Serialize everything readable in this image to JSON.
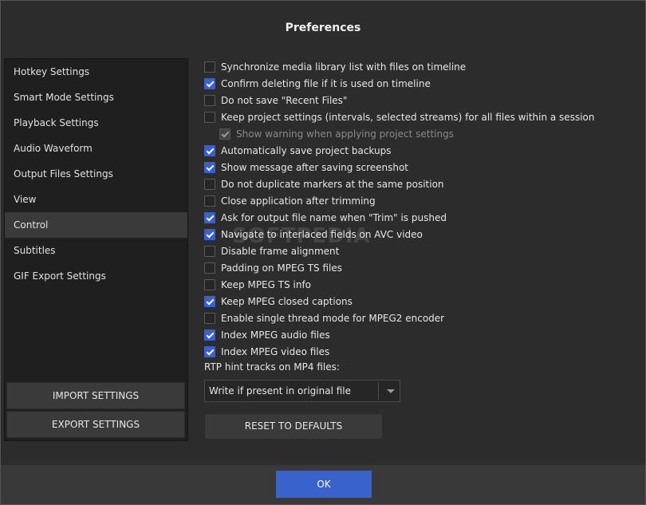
{
  "dialog": {
    "title": "Preferences"
  },
  "sidebar": {
    "items": [
      {
        "label": "Hotkey Settings"
      },
      {
        "label": "Smart Mode Settings"
      },
      {
        "label": "Playback Settings"
      },
      {
        "label": "Audio Waveform"
      },
      {
        "label": "Output Files Settings"
      },
      {
        "label": "View"
      },
      {
        "label": "Control",
        "active": true
      },
      {
        "label": "Subtitles"
      },
      {
        "label": "GIF Export Settings"
      }
    ],
    "import_label": "IMPORT SETTINGS",
    "export_label": "EXPORT SETTINGS"
  },
  "options": [
    {
      "label": "Synchronize media library list with files on timeline",
      "checked": false
    },
    {
      "label": "Confirm deleting file if it is used on timeline",
      "checked": true
    },
    {
      "label": "Do not save \"Recent Files\"",
      "checked": false
    },
    {
      "label": "Keep project settings (intervals, selected streams) for all files within a session",
      "checked": false
    },
    {
      "label": "Show warning when applying project settings",
      "checked": true,
      "disabled": true
    },
    {
      "label": "Automatically save project backups",
      "checked": true
    },
    {
      "label": "Show message after saving screenshot",
      "checked": true
    },
    {
      "label": "Do not duplicate markers at the same position",
      "checked": false
    },
    {
      "label": "Close application after trimming",
      "checked": false
    },
    {
      "label": "Ask for output file name when \"Trim\" is pushed",
      "checked": true
    },
    {
      "label": "Navigate to interlaced fields on AVC video",
      "checked": true
    },
    {
      "label": "Disable frame alignment",
      "checked": false
    },
    {
      "label": "Padding on MPEG TS files",
      "checked": false
    },
    {
      "label": "Keep MPEG TS info",
      "checked": false
    },
    {
      "label": "Keep MPEG closed captions",
      "checked": true
    },
    {
      "label": "Enable single thread mode for MPEG2 encoder",
      "checked": false
    },
    {
      "label": "Index MPEG audio files",
      "checked": true
    },
    {
      "label": "Index MPEG video files",
      "checked": true
    }
  ],
  "rtp": {
    "label": "RTP hint tracks on MP4 files:",
    "selected": "Write if present in original file"
  },
  "reset_label": "RESET TO DEFAULTS",
  "ok_label": "OK",
  "watermark": "SOFTPEDIA",
  "colors": {
    "accent": "#3a62cc",
    "checkbox_on": "#3a5fd0",
    "background": "#2c2c2c"
  }
}
